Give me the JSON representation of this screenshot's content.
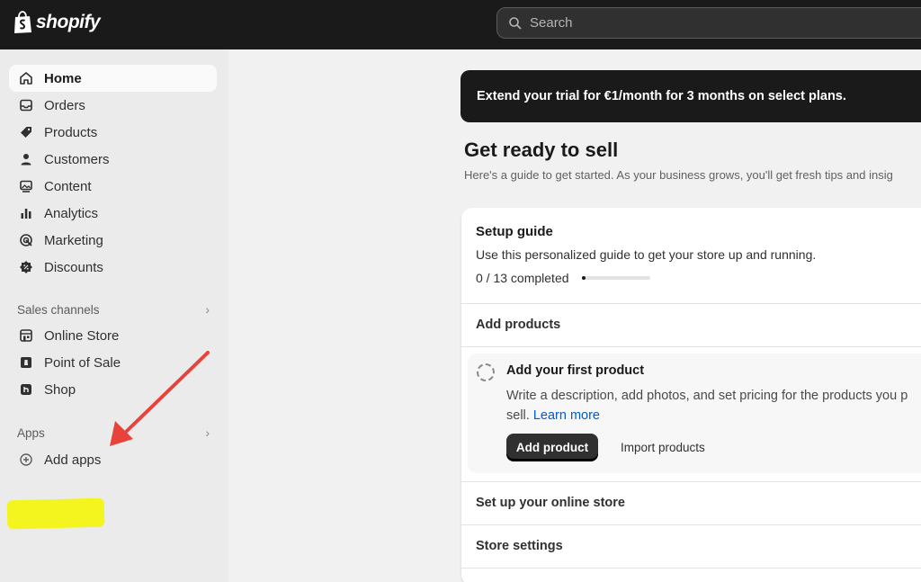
{
  "topbar": {
    "brand": "shopify",
    "search_placeholder": "Search"
  },
  "sidebar": {
    "items": [
      {
        "label": "Home",
        "icon": "home-icon",
        "active": true
      },
      {
        "label": "Orders",
        "icon": "inbox-icon"
      },
      {
        "label": "Products",
        "icon": "tag-icon"
      },
      {
        "label": "Customers",
        "icon": "person-icon"
      },
      {
        "label": "Content",
        "icon": "image-icon"
      },
      {
        "label": "Analytics",
        "icon": "bar-chart-icon"
      },
      {
        "label": "Marketing",
        "icon": "target-icon"
      },
      {
        "label": "Discounts",
        "icon": "discount-icon"
      }
    ],
    "sales_channels": {
      "title": "Sales channels",
      "items": [
        {
          "label": "Online Store",
          "icon": "store-icon"
        },
        {
          "label": "Point of Sale",
          "icon": "pos-icon"
        },
        {
          "label": "Shop",
          "icon": "shop-icon"
        }
      ]
    },
    "apps": {
      "title": "Apps",
      "add_label": "Add apps"
    }
  },
  "main": {
    "banner": "Extend your trial for €1/month for 3 months on select plans.",
    "title": "Get ready to sell",
    "subtitle": "Here's a guide to get started. As your business grows, you'll get fresh tips and insig",
    "setup_guide": {
      "title": "Setup guide",
      "description": "Use this personalized guide to get your store up and running.",
      "progress_text": "0 / 13 completed",
      "progress_fraction": 0.0
    },
    "sections": {
      "add_products": "Add products",
      "online_store": "Set up your online store",
      "store_settings": "Store settings"
    },
    "task": {
      "title": "Add your first product",
      "description": "Write a description, add photos, and set pricing for the products you p",
      "description_cont": "sell.",
      "learn_more": "Learn more",
      "primary_button": "Add product",
      "secondary_button": "Import products"
    }
  },
  "colors": {
    "topbar": "#1a1a1a",
    "sidebar": "#ebebeb",
    "highlight": "#f4f41e",
    "arrow": "#e8433a",
    "link": "#005bd3"
  }
}
